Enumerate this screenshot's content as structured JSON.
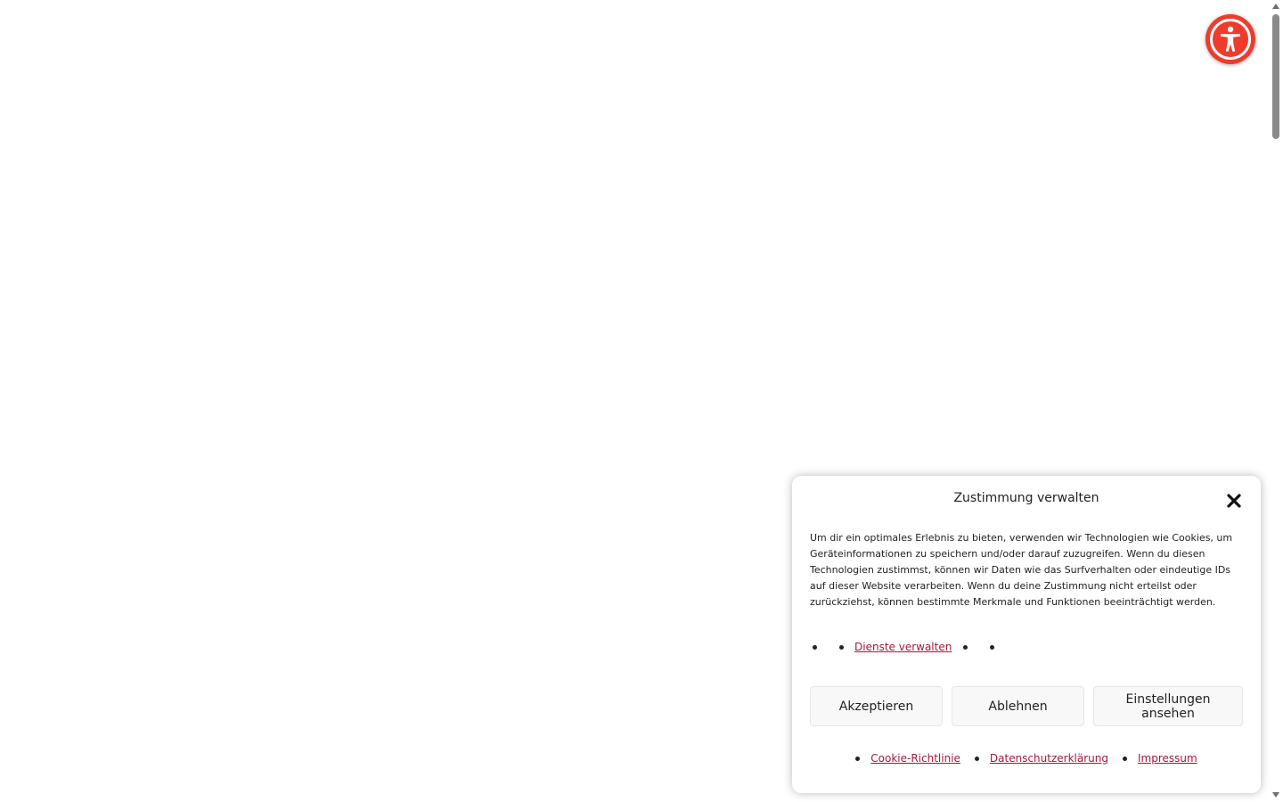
{
  "accessibility": {
    "icon": "accessibility-person-icon",
    "color": "#ef3b2c"
  },
  "consent": {
    "title": "Zustimmung verwalten",
    "close_icon": "close-icon",
    "body": "Um dir ein optimales Erlebnis zu bieten, verwenden wir Technologien wie Cookies, um Geräteinformationen zu speichern und/oder darauf zuzugreifen. Wenn du diesen Technologien zustimmst, können wir Daten wie das Surfverhalten oder eindeutige IDs auf dieser Website verarbeiten. Wenn du deine Zustimmung nicht erteilst oder zurückziehst, können bestimmte Merkmale und Funktionen beeinträchtigt werden.",
    "manage_services_link": "Dienste verwalten",
    "buttons": {
      "accept": "Akzeptieren",
      "deny": "Ablehnen",
      "preferences": "Einstellungen ansehen"
    },
    "footer_links": [
      "Cookie-Richtlinie",
      "Datenschutzerklärung",
      "Impressum"
    ],
    "link_color": "#a3193a"
  }
}
